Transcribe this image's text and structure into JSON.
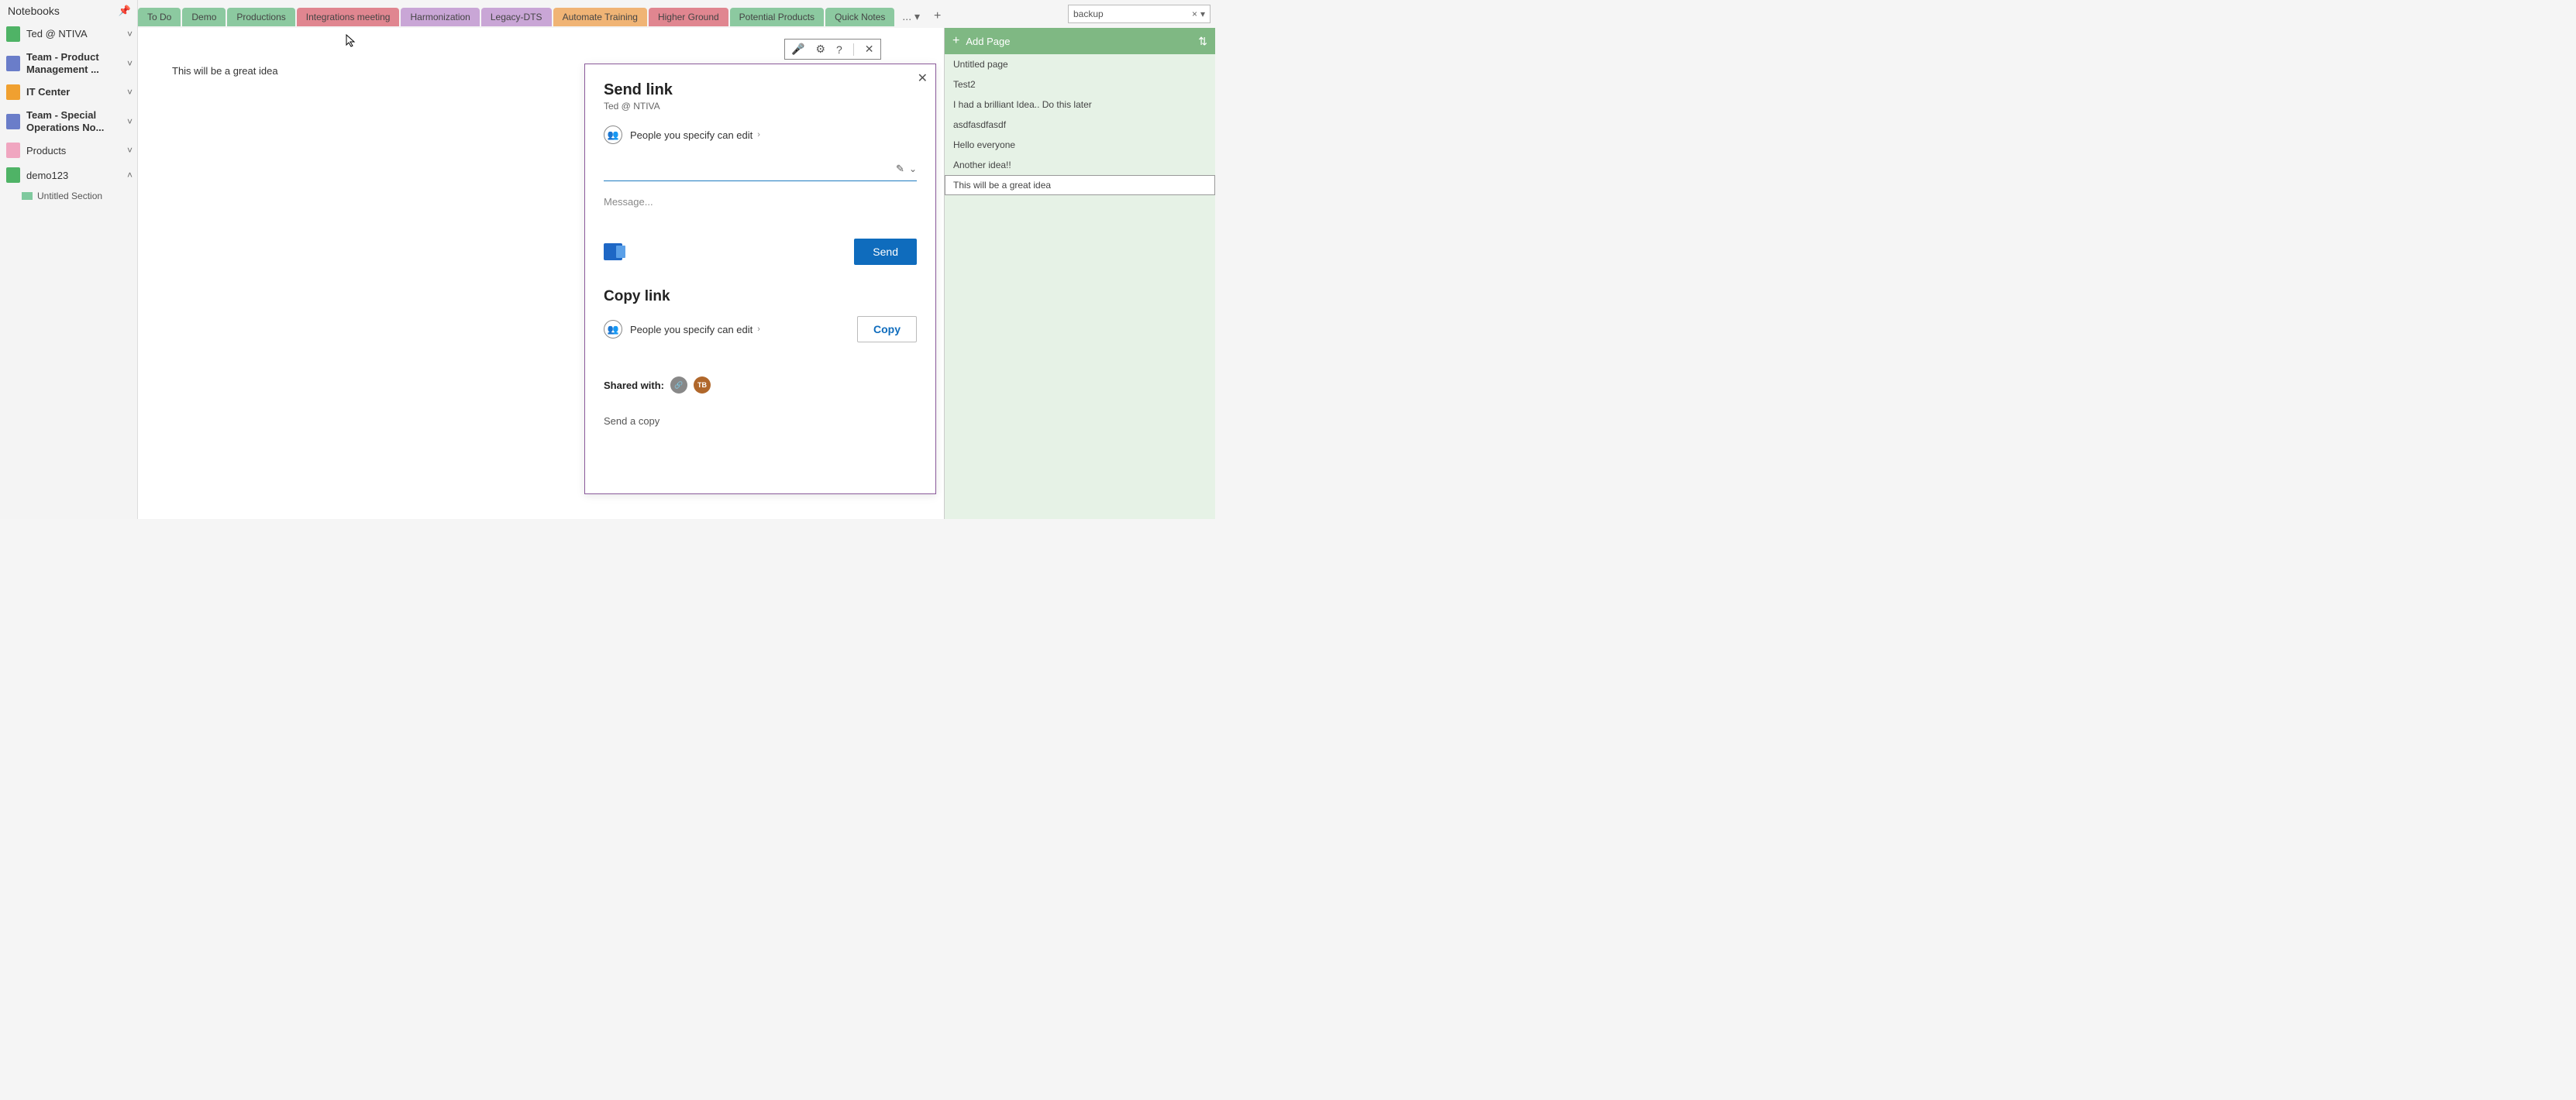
{
  "sidebar": {
    "title": "Notebooks",
    "notebooks": [
      {
        "label": "Ted @ NTIVA",
        "color": "#4fb366",
        "bold": false,
        "expanded": false
      },
      {
        "label": "Team - Product Management ...",
        "color": "#6a7dc9",
        "bold": true,
        "expanded": false
      },
      {
        "label": "IT Center",
        "color": "#f0a030",
        "bold": true,
        "expanded": false
      },
      {
        "label": "Team - Special Operations No...",
        "color": "#6a7dc9",
        "bold": true,
        "expanded": false
      },
      {
        "label": "Products",
        "color": "#f0a6c0",
        "bold": false,
        "expanded": false
      },
      {
        "label": "demo123",
        "color": "#4fb366",
        "bold": false,
        "expanded": true
      }
    ],
    "section": "Untitled Section"
  },
  "tabs": [
    {
      "label": "To Do",
      "color": "#8cc9a0"
    },
    {
      "label": "Demo",
      "color": "#8cc9a0"
    },
    {
      "label": "Productions",
      "color": "#8cc9a0"
    },
    {
      "label": "Integrations meeting",
      "color": "#e08690"
    },
    {
      "label": "Harmonization",
      "color": "#c9a6d6"
    },
    {
      "label": "Legacy-DTS",
      "color": "#c9a6d6"
    },
    {
      "label": "Automate Training",
      "color": "#f0b475"
    },
    {
      "label": "Higher Ground",
      "color": "#e08690"
    },
    {
      "label": "Potential Products",
      "color": "#8cc9a0"
    },
    {
      "label": "Quick Notes",
      "color": "#8cc9a0"
    }
  ],
  "tabs_overflow": "...",
  "search": {
    "value": "backup",
    "clear": "×"
  },
  "pages": {
    "add_label": "Add Page",
    "items": [
      "Untitled page",
      "Test2",
      "I had a brilliant Idea.. Do this later",
      "asdfasdfasdf",
      "Hello everyone",
      "Another idea!!",
      "This will be a great idea"
    ],
    "selected_index": 6
  },
  "canvas": {
    "note_text": "This will be a great idea"
  },
  "dialog": {
    "title": "Send link",
    "subtitle": "Ted @ NTIVA",
    "permission": "People you specify can edit",
    "recipient_placeholder": "",
    "message_placeholder": "Message...",
    "send_label": "Send",
    "copy_title": "Copy link",
    "copy_permission": "People you specify can edit",
    "copy_label": "Copy",
    "shared_label": "Shared with:",
    "avatar2": "TB",
    "send_copy": "Send a copy"
  }
}
